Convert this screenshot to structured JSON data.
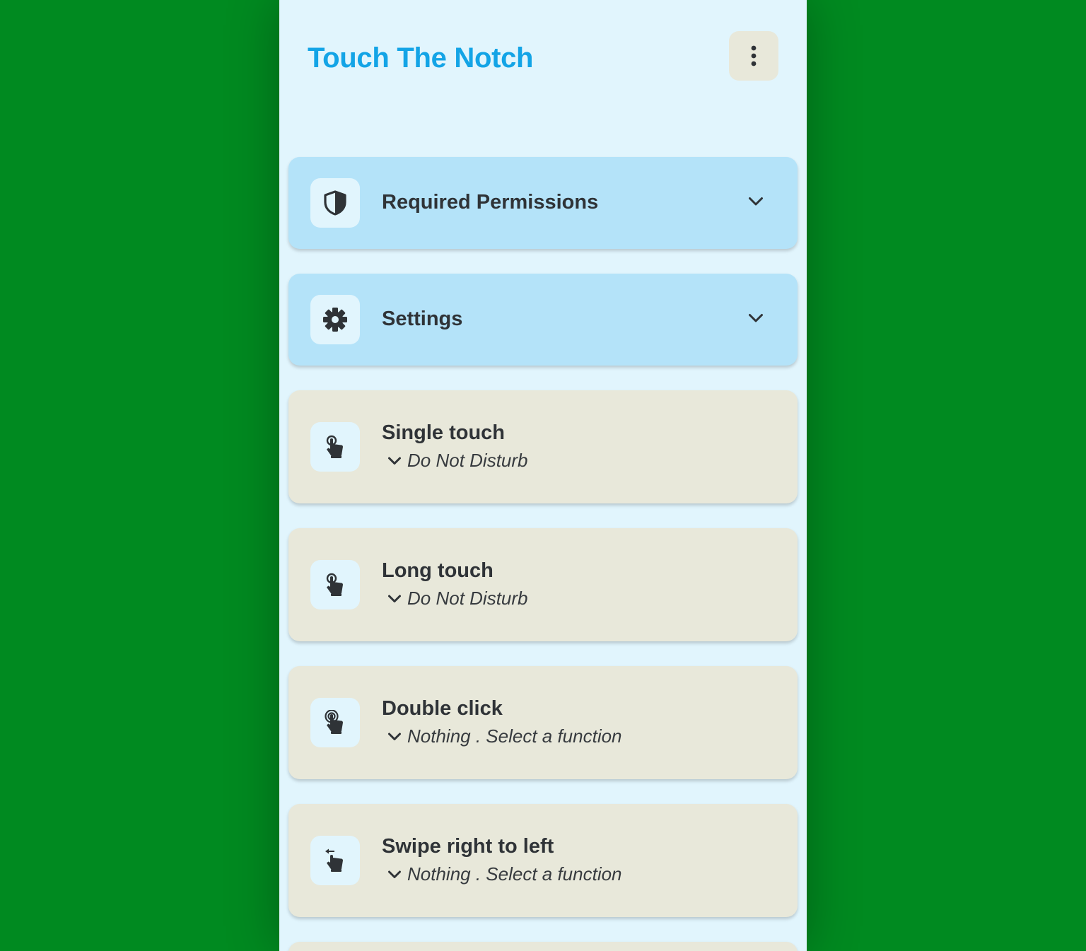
{
  "app": {
    "title": "Touch The Notch"
  },
  "header": {
    "menu_icon": "more-vertical-icon"
  },
  "colors": {
    "background": "#008a20",
    "panel": "#e1f5fd",
    "title": "#13a4e6",
    "card_blue": "#b4e3f9",
    "card_beige": "#e8e8da",
    "text": "#2f3337"
  },
  "sections": [
    {
      "title": "Required Permissions",
      "icon": "shield-icon"
    },
    {
      "title": "Settings",
      "icon": "gear-icon"
    }
  ],
  "gestures": [
    {
      "title": "Single touch",
      "value": "Do Not Disturb",
      "icon": "touch-icon"
    },
    {
      "title": "Long touch",
      "value": "Do Not Disturb",
      "icon": "touch-icon"
    },
    {
      "title": "Double click",
      "value": "Nothing . Select a function",
      "icon": "double-tap-icon"
    },
    {
      "title": "Swipe right to left",
      "value": "Nothing . Select a function",
      "icon": "swipe-left-icon"
    }
  ]
}
